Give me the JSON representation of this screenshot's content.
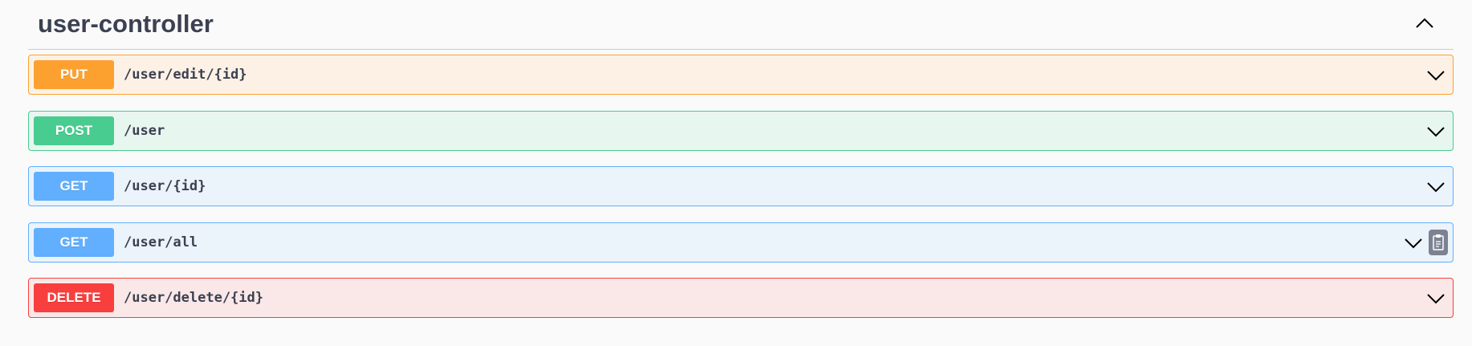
{
  "tag": {
    "title": "user-controller",
    "collapse_icon": "chevron-up-icon"
  },
  "operations": [
    {
      "method": "PUT",
      "path": "/user/edit/{id}",
      "color": "#fca130",
      "expand_icon": "chevron-down-icon"
    },
    {
      "method": "POST",
      "path": "/user",
      "color": "#49cc90",
      "expand_icon": "chevron-down-icon"
    },
    {
      "method": "GET",
      "path": "/user/{id}",
      "color": "#61affe",
      "expand_icon": "chevron-down-icon"
    },
    {
      "method": "GET",
      "path": "/user/all",
      "color": "#61affe",
      "expand_icon": "chevron-down-icon",
      "copy_icon": "clipboard-copy-icon"
    },
    {
      "method": "DELETE",
      "path": "/user/delete/{id}",
      "color": "#f93e3e",
      "expand_icon": "chevron-down-icon"
    }
  ]
}
